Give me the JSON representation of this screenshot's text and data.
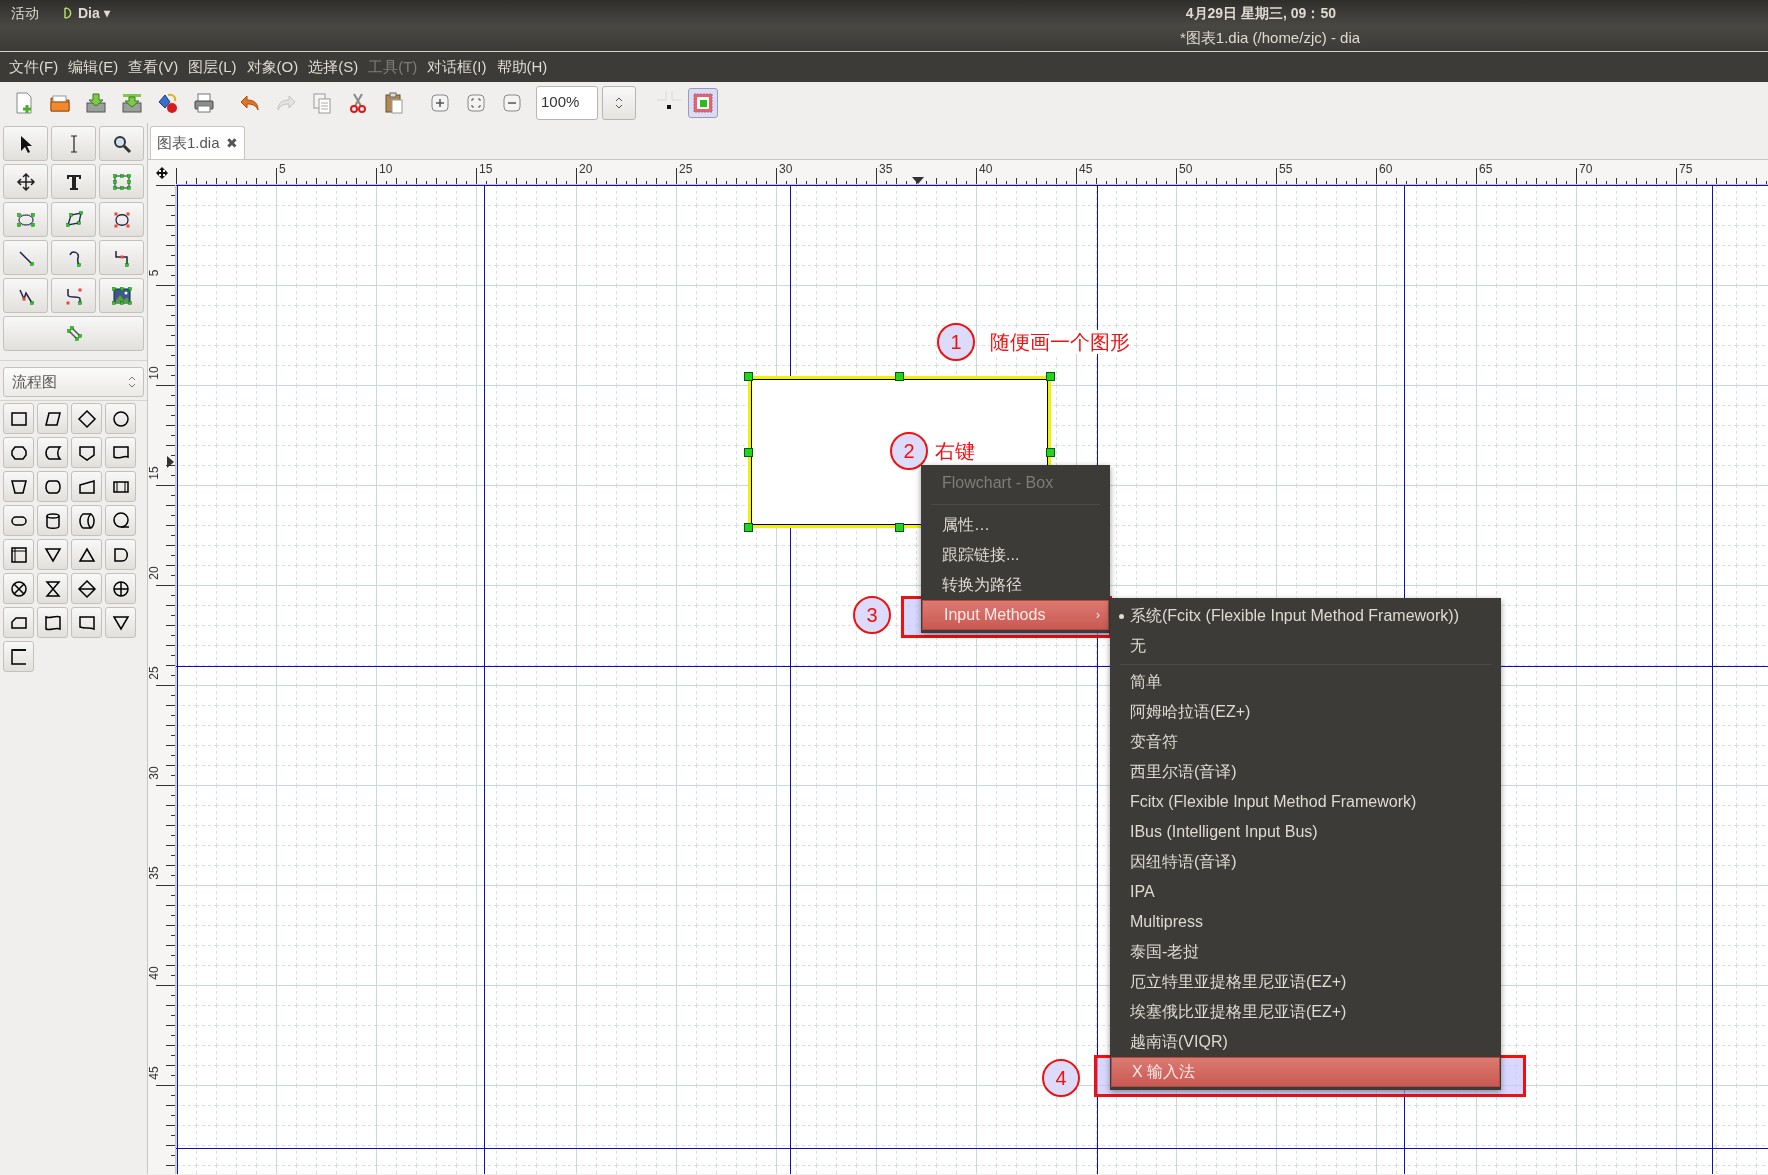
{
  "top_bar": {
    "activities": "活动",
    "app": "Dia",
    "app_caret": "▾",
    "clock": "4月29日 星期三, 09：50"
  },
  "window": {
    "title": "*图表1.dia (/home/zjc) - dia"
  },
  "menu_bar": [
    {
      "label": "文件(F)",
      "disabled": false
    },
    {
      "label": "编辑(E)",
      "disabled": false
    },
    {
      "label": "查看(V)",
      "disabled": false
    },
    {
      "label": "图层(L)",
      "disabled": false
    },
    {
      "label": "对象(O)",
      "disabled": false
    },
    {
      "label": "选择(S)",
      "disabled": false
    },
    {
      "label": "工具(T)",
      "disabled": true
    },
    {
      "label": "对话框(I)",
      "disabled": false
    },
    {
      "label": "帮助(H)",
      "disabled": false
    }
  ],
  "toolbar": {
    "zoom": "100%"
  },
  "toolbox": {
    "sheet": "流程图"
  },
  "tabs": [
    {
      "label": "图表1.dia",
      "close": "✖",
      "selected": true
    }
  ],
  "rulers": {
    "horizontal": [
      "5",
      "10",
      "15",
      "20",
      "25",
      "30",
      "35",
      "40",
      "45",
      "50",
      "55",
      "60",
      "65",
      "70",
      "75"
    ],
    "vertical": [
      "5",
      "10",
      "15",
      "20",
      "25",
      "30",
      "35",
      "40",
      "45"
    ]
  },
  "annotations": [
    {
      "number": "1",
      "text": "随便画一个图形"
    },
    {
      "number": "2",
      "text": "右键"
    },
    {
      "number": "3"
    },
    {
      "number": "4"
    }
  ],
  "context_menu": {
    "items": [
      {
        "kind": "item",
        "label": "Flowchart - Box",
        "disabled": true,
        "selected": false
      },
      {
        "kind": "separator"
      },
      {
        "kind": "item",
        "label": "属性…",
        "disabled": false,
        "selected": false
      },
      {
        "kind": "item",
        "label": "跟踪链接...",
        "disabled": false,
        "selected": false
      },
      {
        "kind": "item",
        "label": "转换为路径",
        "disabled": false,
        "selected": false
      },
      {
        "kind": "item",
        "label": "Input Methods",
        "disabled": false,
        "selected": true,
        "submenu": "›"
      }
    ]
  },
  "submenu": {
    "items": [
      {
        "kind": "item",
        "label": "系统(Fcitx (Flexible Input Method Framework))",
        "checked": true,
        "selected": false
      },
      {
        "kind": "item",
        "label": "无",
        "checked": false,
        "selected": false
      },
      {
        "kind": "separator"
      },
      {
        "kind": "item",
        "label": "简单",
        "checked": false,
        "selected": false
      },
      {
        "kind": "item",
        "label": "阿姆哈拉语(EZ+)",
        "checked": false,
        "selected": false
      },
      {
        "kind": "item",
        "label": "变音符",
        "checked": false,
        "selected": false
      },
      {
        "kind": "item",
        "label": "西里尔语(音译)",
        "checked": false,
        "selected": false
      },
      {
        "kind": "item",
        "label": "Fcitx (Flexible Input Method Framework)",
        "checked": false,
        "selected": false
      },
      {
        "kind": "item",
        "label": "IBus (Intelligent Input Bus)",
        "checked": false,
        "selected": false
      },
      {
        "kind": "item",
        "label": "因纽特语(音译)",
        "checked": false,
        "selected": false
      },
      {
        "kind": "item",
        "label": "IPA",
        "checked": false,
        "selected": false
      },
      {
        "kind": "item",
        "label": "Multipress",
        "checked": false,
        "selected": false
      },
      {
        "kind": "item",
        "label": "泰国-老挝",
        "checked": false,
        "selected": false
      },
      {
        "kind": "item",
        "label": "厄立特里亚提格里尼亚语(EZ+)",
        "checked": false,
        "selected": false
      },
      {
        "kind": "item",
        "label": "埃塞俄比亚提格里尼亚语(EZ+)",
        "checked": false,
        "selected": false
      },
      {
        "kind": "item",
        "label": "越南语(VIQR)",
        "checked": false,
        "selected": false
      },
      {
        "kind": "item",
        "label": "X 输入法",
        "checked": false,
        "selected": true
      }
    ]
  }
}
